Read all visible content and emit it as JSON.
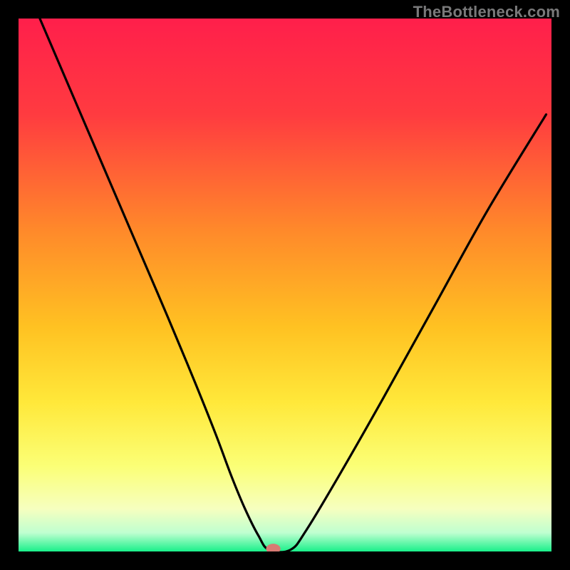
{
  "watermark": "TheBottleneck.com",
  "chart_data": {
    "type": "line",
    "title": "",
    "xlabel": "",
    "ylabel": "",
    "xlim": [
      0,
      100
    ],
    "ylim": [
      0,
      100
    ],
    "grid": false,
    "legend": false,
    "series": [
      {
        "name": "bottleneck-curve",
        "x": [
          4,
          10,
          16,
          22,
          28,
          33,
          37,
          40,
          42.5,
          45,
          47,
          51,
          54,
          60,
          68,
          78,
          88,
          99
        ],
        "values": [
          100,
          86,
          72,
          58,
          44,
          32,
          22,
          14,
          8,
          3,
          0.3,
          0.3,
          4,
          14,
          28,
          46,
          64,
          82
        ]
      }
    ],
    "gradient_stops": [
      {
        "offset": 0,
        "color": "#ff1f4b"
      },
      {
        "offset": 18,
        "color": "#ff3b40"
      },
      {
        "offset": 40,
        "color": "#ff8a2a"
      },
      {
        "offset": 58,
        "color": "#ffc222"
      },
      {
        "offset": 72,
        "color": "#ffe83a"
      },
      {
        "offset": 84,
        "color": "#fbff76"
      },
      {
        "offset": 92,
        "color": "#f6ffbf"
      },
      {
        "offset": 96.5,
        "color": "#bfffd0"
      },
      {
        "offset": 100,
        "color": "#19f08a"
      }
    ],
    "marker": {
      "x": 47.8,
      "y": 0.5,
      "color": "#d87a73"
    }
  }
}
